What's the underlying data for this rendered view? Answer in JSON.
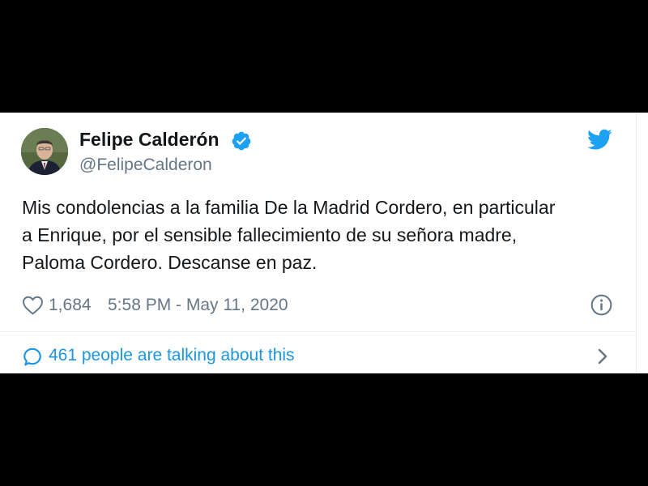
{
  "tweet": {
    "display_name": "Felipe Calderón",
    "handle": "@FelipeCalderon",
    "verified": true,
    "text_lines": [
      "Mis condolencias a la familia De la Madrid Cordero, en particular",
      "a Enrique, por el sensible fallecimiento de su señora madre,",
      "Paloma Cordero. Descanse en paz."
    ],
    "like_count": "1,684",
    "timestamp": "5:58 PM - May 11, 2020",
    "talking_about": "461 people are talking about this"
  },
  "icons": {
    "brand": "twitter-bird-icon",
    "verified": "verified-badge-icon",
    "like": "heart-icon",
    "info": "info-icon",
    "reply": "speech-bubble-icon",
    "chevron": "chevron-right-icon"
  },
  "colors": {
    "twitter_blue": "#1da1f2",
    "link_blue": "#1b95e0",
    "text_primary": "#14171a",
    "text_secondary": "#657786",
    "divider": "#e6ecf0",
    "letterbox": "#000000"
  }
}
